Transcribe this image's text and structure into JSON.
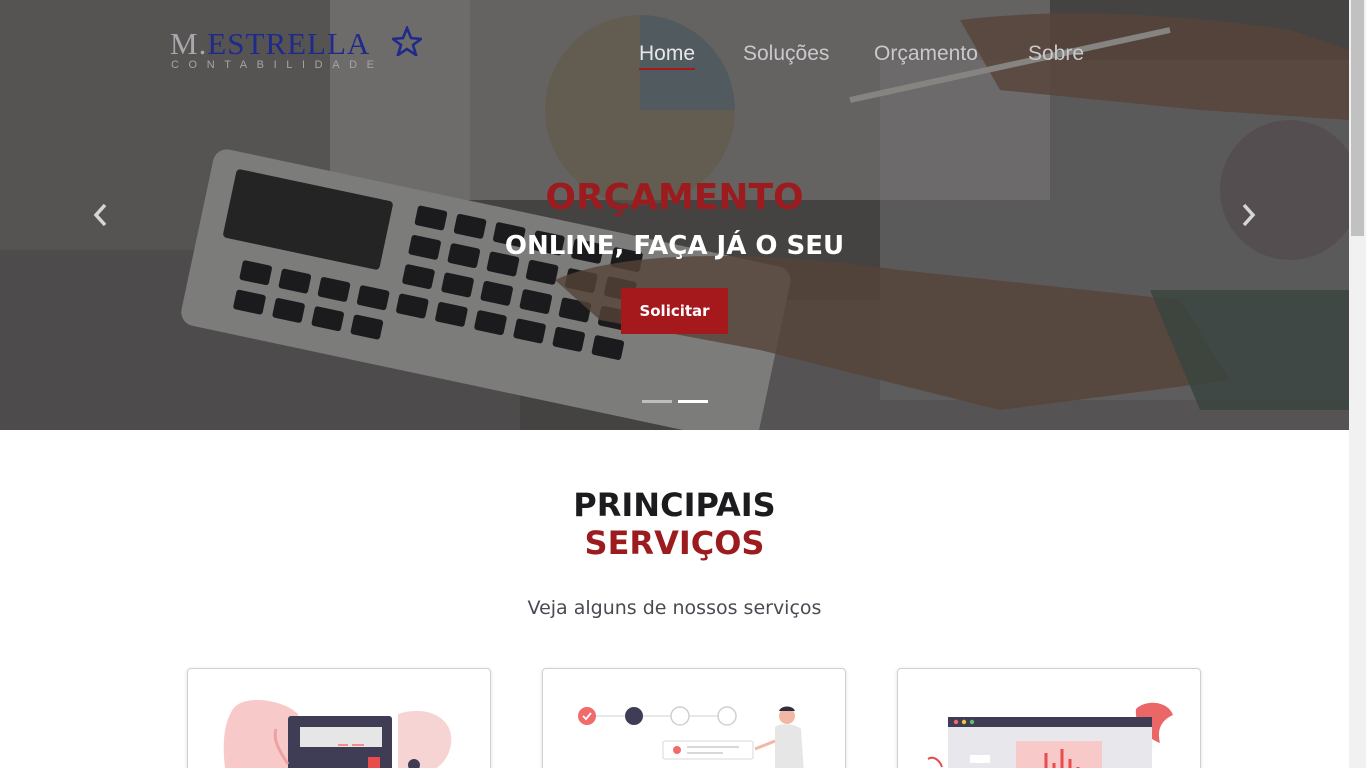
{
  "logo": {
    "main_m": "M.",
    "main_e": "ESTRELLA",
    "sub": "CONTABILIDADE"
  },
  "nav": {
    "items": [
      {
        "label": "Home",
        "active": true
      },
      {
        "label": "Soluções",
        "active": false
      },
      {
        "label": "Orçamento",
        "active": false
      },
      {
        "label": "Sobre",
        "active": false
      }
    ]
  },
  "hero": {
    "title": "ORÇAMENTO",
    "subtitle": "ONLINE, FAÇA JÁ O SEU",
    "button_label": "Solicitar",
    "slides_count": 2,
    "active_slide": 2,
    "prev_icon": "chevron-left-icon",
    "next_icon": "chevron-right-icon"
  },
  "services": {
    "title_line1": "PRINCIPAIS",
    "title_line2": "SERVIÇOS",
    "subtitle": "Veja alguns de nossos serviços"
  },
  "colors": {
    "brand_red": "#a5181c",
    "brand_blue": "#1f2a8a",
    "dark_text": "#1c1c1f",
    "muted_text": "#4a4a52"
  }
}
